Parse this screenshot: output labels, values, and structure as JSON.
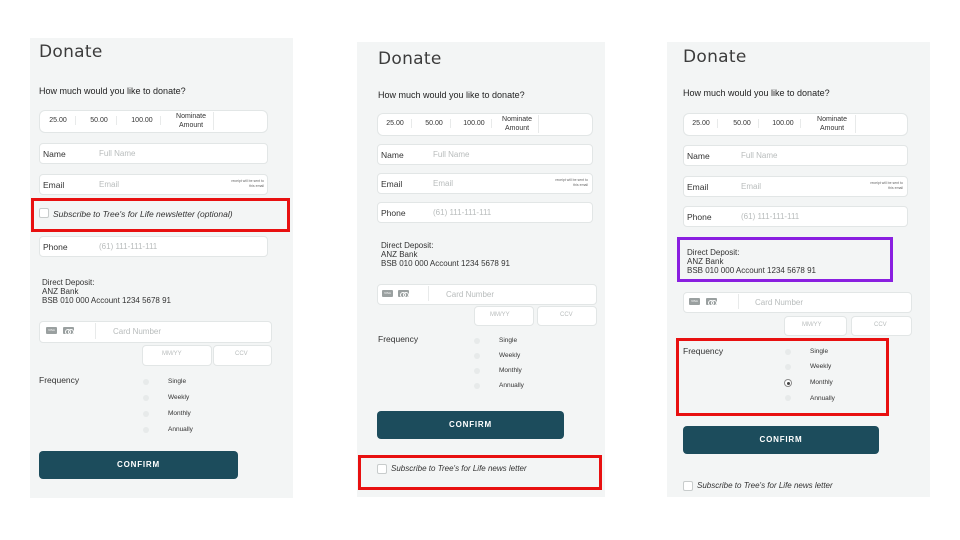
{
  "screens": [
    {
      "title": "Donate",
      "question": "How much would you like to donate?",
      "amounts": [
        "25.00",
        "50.00",
        "100.00"
      ],
      "nominate": "Nominate Amount",
      "name_label": "Name",
      "name_placeholder": "Full Name",
      "email_label": "Email",
      "email_placeholder": "Email",
      "receipt_note": "receipt will be sent to this email",
      "subscribe_label": "Subscribe to Tree's for Life newsletter (optional)",
      "phone_label": "Phone",
      "phone_placeholder": "(61) 111-111-111",
      "deposit_lines": [
        "Direct Deposit:",
        "ANZ Bank",
        "BSB 010 000 Account 1234 5678 91"
      ],
      "card_brand_visa": "VISA",
      "card_placeholder": "Card Number",
      "expiry_placeholder": "MM/YY",
      "ccv_placeholder": "CCV",
      "frequency_label": "Frequency",
      "frequency_options": [
        "Single",
        "Weekly",
        "Monthly",
        "Annually"
      ],
      "frequency_selected": "",
      "confirm_label": "CONFIRM"
    },
    {
      "title": "Donate",
      "question": "How much would you like to donate?",
      "amounts": [
        "25.00",
        "50.00",
        "100.00"
      ],
      "nominate": "Nominate Amount",
      "name_label": "Name",
      "name_placeholder": "Full Name",
      "email_label": "Email",
      "email_placeholder": "Email",
      "receipt_note": "receipt will be sent to this email",
      "phone_label": "Phone",
      "phone_placeholder": "(61) 111-111-111",
      "deposit_lines": [
        "Direct Deposit:",
        "ANZ Bank",
        "BSB 010 000 Account 1234 5678 91"
      ],
      "card_brand_visa": "VISA",
      "card_placeholder": "Card Number",
      "expiry_placeholder": "MM/YY",
      "ccv_placeholder": "CCV",
      "frequency_label": "Frequency",
      "frequency_options": [
        "Single",
        "Weekly",
        "Monthly",
        "Annually"
      ],
      "frequency_selected": "",
      "confirm_label": "CONFIRM",
      "subscribe_label": "Subscribe to Tree's for Life news letter"
    },
    {
      "title": "Donate",
      "question": "How much would you like to donate?",
      "amounts": [
        "25.00",
        "50.00",
        "100.00"
      ],
      "nominate": "Nominate Amount",
      "name_label": "Name",
      "name_placeholder": "Full Name",
      "email_label": "Email",
      "email_placeholder": "Email",
      "receipt_note": "receipt will be sent to this email",
      "phone_label": "Phone",
      "phone_placeholder": "(61) 111-111-111",
      "deposit_lines": [
        "Direct Deposit:",
        "ANZ Bank",
        "BSB 010 000 Account 1234 5678 91"
      ],
      "card_brand_visa": "VISA",
      "card_placeholder": "Card Number",
      "expiry_placeholder": "MM/YY",
      "ccv_placeholder": "CCV",
      "frequency_label": "Frequency",
      "frequency_options": [
        "Single",
        "Weekly",
        "Monthly",
        "Annually"
      ],
      "frequency_selected": "Monthly",
      "confirm_label": "CONFIRM",
      "subscribe_label": "Subscribe to Tree's for Life news letter"
    }
  ],
  "colors": {
    "panel_bg": "#f3f5f5",
    "confirm_bg": "#1c4c5c",
    "highlight_red": "#e81010",
    "highlight_purple": "#8a1fe0"
  }
}
